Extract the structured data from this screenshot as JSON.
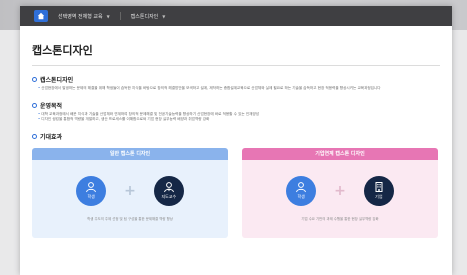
{
  "topbar": {
    "breadcrumb": [
      {
        "label": "선택영역 전체형 교육"
      },
      {
        "label": "캡스톤디자인"
      }
    ]
  },
  "page_title": "캡스톤디자인",
  "sections": {
    "intro": {
      "heading": "캡스톤디자인",
      "text": "산업현장에서 발생하는 문제의 해결을 위해 학생들이 습득한 지식을 바탕으로 창의적 해결방안을 모색하고 설계, 제작하는 종합설계교육으로 산업체와 실제 필요로 하는 기술을 습득하고 현장 적응력을 향상시키는 교육과정입니다"
    },
    "purpose": {
      "heading": "운영목적",
      "items": [
        "대학 교육과정에서 배운 지식과 기술을 산업체와 연계하여 창의적 문제해결 및 전공기술능력을 향상하기 산업현장에 바로 적용할 수 있는 인재양성",
        "디자인 씽킹을 통합적 역량을 개발하고, 생산 프로세스를 이해함으로써 기업 현장 실무능력 배양과 취업역량 강화"
      ]
    },
    "effects": {
      "heading": "기대효과",
      "panels": [
        {
          "title": "일반 캡스톤 디자인",
          "left": "학생",
          "right": "지도교수",
          "footer": "학생 주도의 주제 선정 및 팀 구성을 통한 문제해결 역량 향상"
        },
        {
          "title": "기업연계 캡스톤 디자인",
          "left": "학생",
          "right": "기업",
          "footer": "기업 수요 기반의 과제 수행을 통한 현장 실무역량 강화"
        }
      ]
    }
  },
  "colors": {
    "accent": "#2f6fd8",
    "blue_panel_head": "#8ab3ec",
    "pink_panel_head": "#e776b4",
    "navy": "#152746"
  }
}
